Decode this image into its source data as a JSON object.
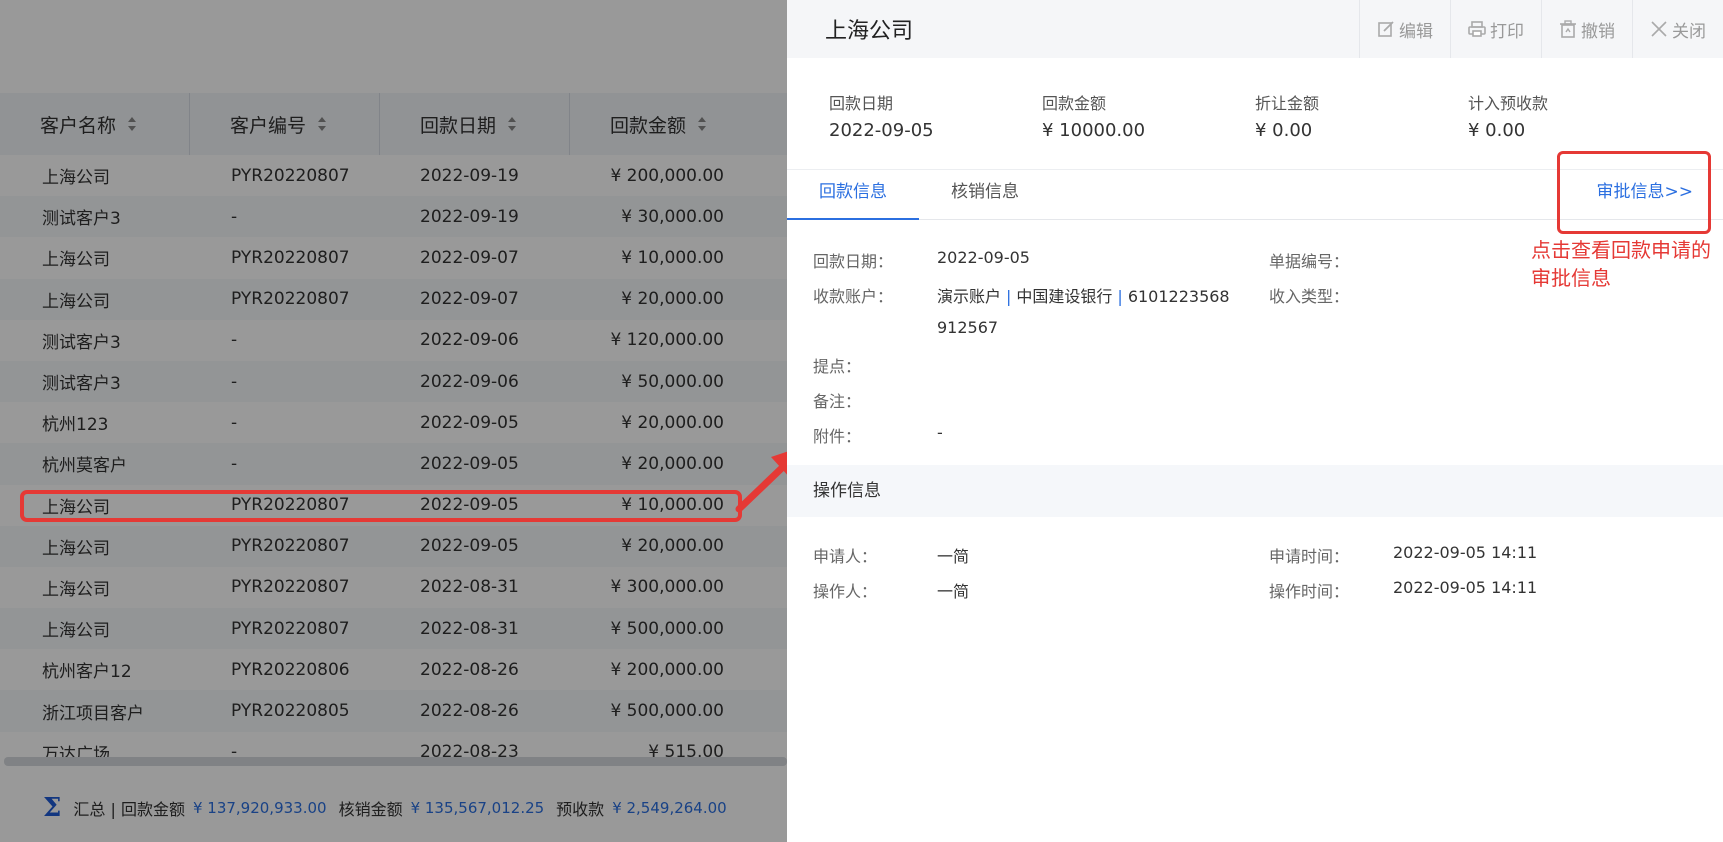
{
  "list": {
    "columns": [
      "客户名称",
      "客户编号",
      "回款日期",
      "回款金额"
    ],
    "rows": [
      [
        "上海公司",
        "PYR20220807",
        "2022-09-19",
        "¥ 200,000.00"
      ],
      [
        "测试客户3",
        "-",
        "2022-09-19",
        "¥ 30,000.00"
      ],
      [
        "上海公司",
        "PYR20220807",
        "2022-09-07",
        "¥ 10,000.00"
      ],
      [
        "上海公司",
        "PYR20220807",
        "2022-09-07",
        "¥ 20,000.00"
      ],
      [
        "测试客户3",
        "-",
        "2022-09-06",
        "¥ 120,000.00"
      ],
      [
        "测试客户3",
        "-",
        "2022-09-06",
        "¥ 50,000.00"
      ],
      [
        "杭州123",
        "-",
        "2022-09-05",
        "¥ 20,000.00"
      ],
      [
        "杭州莫客户",
        "-",
        "2022-09-05",
        "¥ 20,000.00"
      ],
      [
        "上海公司",
        "PYR20220807",
        "2022-09-05",
        "¥ 10,000.00"
      ],
      [
        "上海公司",
        "PYR20220807",
        "2022-09-05",
        "¥ 20,000.00"
      ],
      [
        "上海公司",
        "PYR20220807",
        "2022-08-31",
        "¥ 300,000.00"
      ],
      [
        "上海公司",
        "PYR20220807",
        "2022-08-31",
        "¥ 500,000.00"
      ],
      [
        "杭州客户12",
        "PYR20220806",
        "2022-08-26",
        "¥ 200,000.00"
      ],
      [
        "浙江项目客户",
        "PYR20220805",
        "2022-08-26",
        "¥ 500,000.00"
      ],
      [
        "万达广场",
        "-",
        "2022-08-23",
        "¥ 515.00"
      ]
    ],
    "summary": {
      "sigma": "Σ",
      "label": "汇总 | 回款金额",
      "payment_total": "¥ 137,920,933.00",
      "writeoff_label": "核销金额",
      "writeoff_total": "¥ 135,567,012.25",
      "prepay_label": "预收款",
      "prepay_total": "¥ 2,549,264.00"
    }
  },
  "drawer": {
    "title": "上海公司",
    "actions": {
      "edit": "编辑",
      "print": "打印",
      "revoke": "撤销",
      "close": "关闭"
    },
    "stats": [
      {
        "label": "回款日期",
        "value": "2022-09-05"
      },
      {
        "label": "回款金额",
        "value": "¥ 10000.00"
      },
      {
        "label": "折让金额",
        "value": "¥ 0.00"
      },
      {
        "label": "计入预收款",
        "value": "¥ 0.00"
      }
    ],
    "tabs": [
      "回款信息",
      "核销信息"
    ],
    "approval_link": "审批信息>>",
    "fields": {
      "date_label": "回款日期：",
      "date_value": "2022-09-05",
      "account_label": "收款账户：",
      "account_name": "演示账户",
      "account_bank": "中国建设银行",
      "account_no_1": "6101223568",
      "account_no_2": "912567",
      "commission_label": "提点：",
      "remark_label": "备注：",
      "attachment_label": "附件：",
      "attachment_value": "-",
      "bill_no_label": "单据编号：",
      "income_type_label": "收入类型："
    },
    "operation": {
      "title": "操作信息",
      "applicant_label": "申请人：",
      "applicant": "一简",
      "apply_time_label": "申请时间：",
      "apply_time": "2022-09-05 14:11",
      "operator_label": "操作人：",
      "operator": "一简",
      "operate_time_label": "操作时间：",
      "operate_time": "2022-09-05 14:11"
    }
  },
  "annotation": "点击查看回款申请的审批信息",
  "colors": {
    "accent": "#2b6fe0",
    "highlight": "#e53935"
  }
}
